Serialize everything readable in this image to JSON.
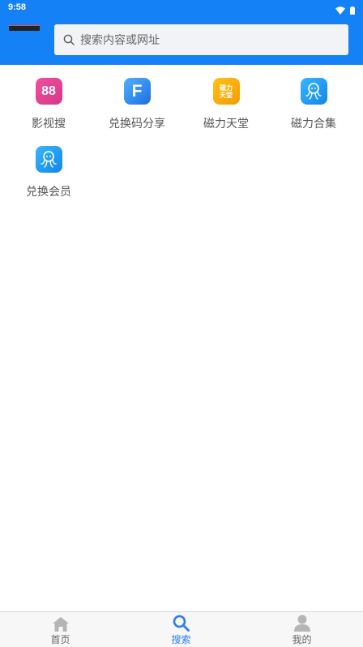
{
  "status_bar": {
    "time": "9:58"
  },
  "search": {
    "placeholder": "搜索内容或网址"
  },
  "grid": {
    "items": [
      {
        "label": "影视搜",
        "icon": "88-app-icon",
        "icon_text": "88"
      },
      {
        "label": "兑换码分享",
        "icon": "f-app-icon",
        "icon_text": "F"
      },
      {
        "label": "磁力天堂",
        "icon": "magnet-heaven-app-icon",
        "icon_text": "磁力天堂"
      },
      {
        "label": "磁力合集",
        "icon": "octopus-app-icon"
      },
      {
        "label": "兑换会员",
        "icon": "octopus-app-icon"
      }
    ]
  },
  "tabbar": {
    "tabs": [
      {
        "label": "首页",
        "icon": "home-icon"
      },
      {
        "label": "搜索",
        "icon": "search-icon"
      },
      {
        "label": "我的",
        "icon": "user-icon"
      }
    ],
    "active_index": 1
  },
  "colors": {
    "brand": "#1481f6",
    "active_tab": "#2a7cf0"
  }
}
